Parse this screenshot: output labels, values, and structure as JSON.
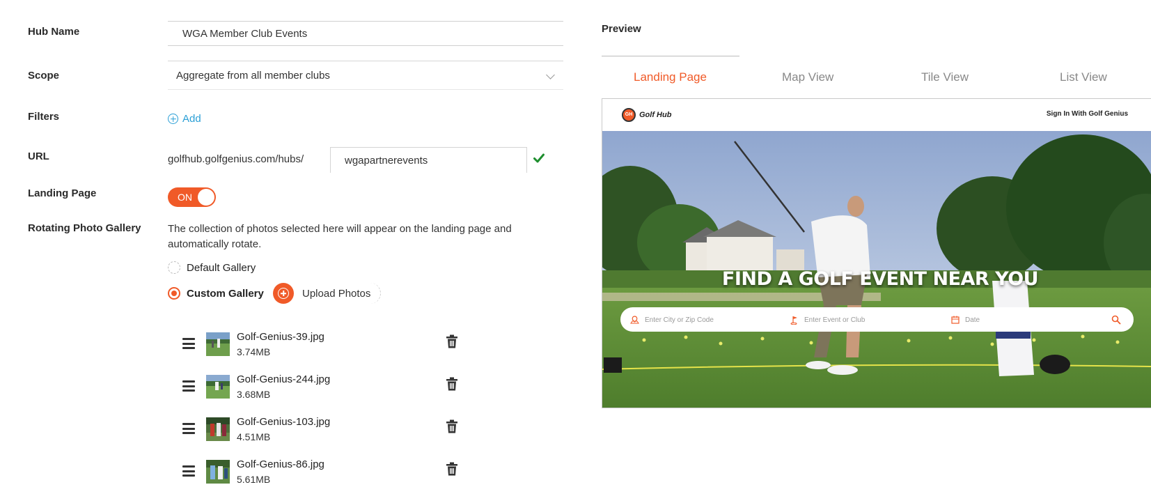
{
  "form": {
    "hub_name_label": "Hub Name",
    "hub_name_value": "WGA Member Club Events",
    "scope_label": "Scope",
    "scope_value": "Aggregate from all member clubs",
    "filters_label": "Filters",
    "filters_add": "Add",
    "url_label": "URL",
    "url_prefix": "golfhub.golfgenius.com/hubs/",
    "url_slug": "wgapartnerevents",
    "landing_page_label": "Landing Page",
    "landing_page_toggle": "ON",
    "gallery_label": "Rotating Photo Gallery",
    "gallery_description": "The collection of photos selected here will appear on the landing page and automatically rotate.",
    "default_gallery": "Default Gallery",
    "custom_gallery": "Custom Gallery",
    "upload_photos": "Upload Photos"
  },
  "photos": [
    {
      "name": "Golf-Genius-39.jpg",
      "size": "3.74MB"
    },
    {
      "name": "Golf-Genius-244.jpg",
      "size": "3.68MB"
    },
    {
      "name": "Golf-Genius-103.jpg",
      "size": "4.51MB"
    },
    {
      "name": "Golf-Genius-86.jpg",
      "size": "5.61MB"
    }
  ],
  "preview": {
    "title": "Preview",
    "tabs": [
      "Landing Page",
      "Map View",
      "Tile View",
      "List View"
    ],
    "active_tab": "Landing Page",
    "logo_mark": "GH",
    "logo_text": "Golf Hub",
    "sign_in": "Sign In With Golf Genius",
    "headline": "FIND A GOLF EVENT NEAR YOU",
    "search": {
      "location_placeholder": "Enter City or Zip Code",
      "event_placeholder": "Enter Event or Club",
      "date_placeholder": "Date"
    }
  },
  "colors": {
    "accent": "#f05a28",
    "link": "#2a9fd6",
    "success": "#1e8e2e"
  },
  "icons": {
    "filters_add": "plus-circle-icon",
    "url_valid": "checkmark-icon",
    "upload": "plus-circle-icon",
    "drag": "drag-handle-icon",
    "delete": "trash-icon",
    "location": "location-pin-icon",
    "event": "flag-icon",
    "date": "calendar-icon",
    "search": "search-icon"
  }
}
